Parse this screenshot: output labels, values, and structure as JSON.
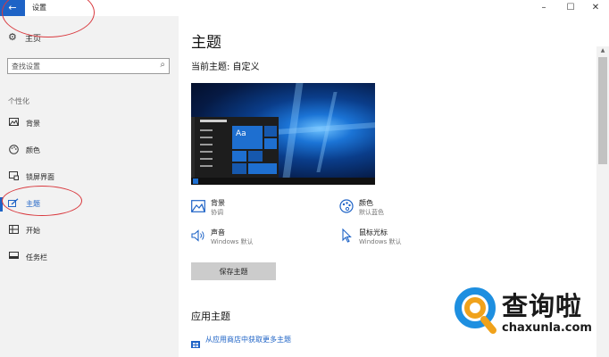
{
  "titlebar": {
    "back_icon": "←",
    "title": "设置",
    "minimize_icon": "–",
    "maximize_icon": "☐",
    "close_icon": "✕"
  },
  "sidebar": {
    "home": {
      "icon": "gear-icon",
      "label": "主页"
    },
    "search": {
      "placeholder": "查找设置",
      "value": ""
    },
    "section_label": "个性化",
    "items": [
      {
        "icon": "picture-icon",
        "label": "背景",
        "active": false
      },
      {
        "icon": "palette-icon",
        "label": "颜色",
        "active": false
      },
      {
        "icon": "lock-screen-icon",
        "label": "锁屏界面",
        "active": false
      },
      {
        "icon": "brush-icon",
        "label": "主题",
        "active": true
      },
      {
        "icon": "start-icon",
        "label": "开始",
        "active": false
      },
      {
        "icon": "taskbar-icon",
        "label": "任务栏",
        "active": false
      }
    ]
  },
  "main": {
    "page_title": "主题",
    "current_theme": "当前主题: 自定义",
    "preview_tile_text": "Aa",
    "options": [
      {
        "icon": "picture-icon",
        "title": "背景",
        "subtitle": "协调"
      },
      {
        "icon": "palette-icon",
        "title": "颜色",
        "subtitle": "默认蓝色"
      },
      {
        "icon": "speaker-icon",
        "title": "声音",
        "subtitle": "Windows 默认"
      },
      {
        "icon": "cursor-icon",
        "title": "鼠标光标",
        "subtitle": "Windows 默认"
      }
    ],
    "save_button": "保存主题",
    "apply_title": "应用主题",
    "store_link": "从应用商店中获取更多主题"
  },
  "watermark": {
    "brand": "查询啦",
    "domain": "chaxunla.com"
  },
  "colors": {
    "accent": "#1e63c6",
    "annotation": "#d9393e",
    "sidebar_bg": "#f2f2f2"
  }
}
